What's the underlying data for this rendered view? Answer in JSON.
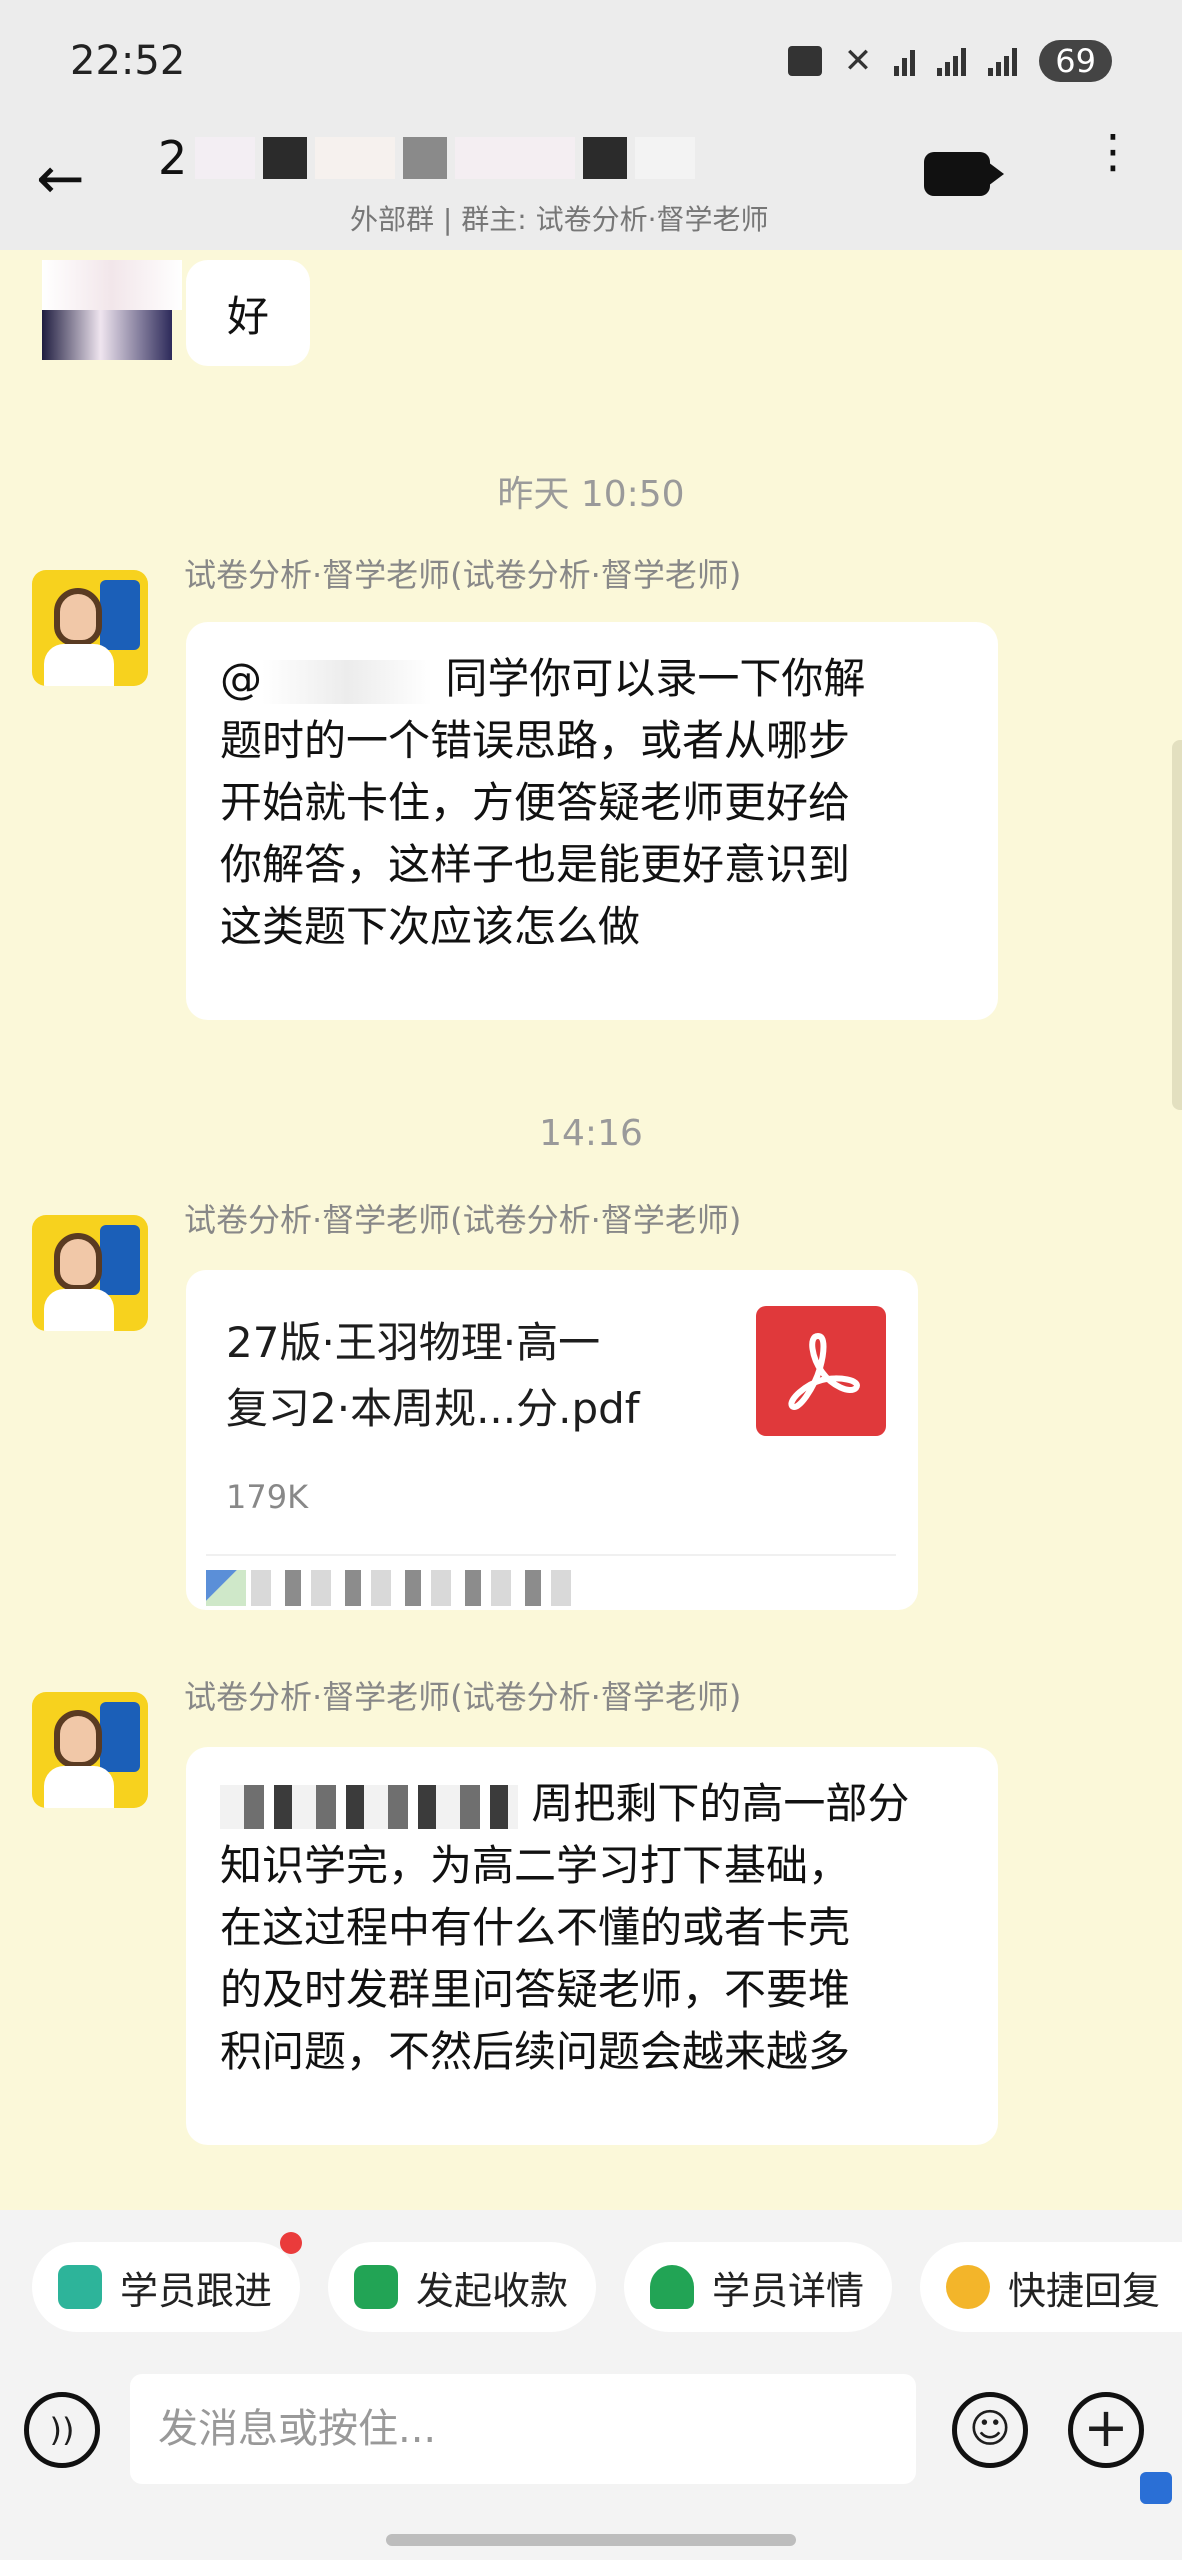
{
  "status_bar": {
    "time": "22:52",
    "battery": "69"
  },
  "header": {
    "title_visible": "2",
    "subtitle": "外部群 | 群主: 试卷分析·督学老师"
  },
  "chat": {
    "messages": [
      {
        "type": "text",
        "sender": "",
        "text": "好"
      },
      {
        "type": "timestamp",
        "text": "昨天 10:50"
      },
      {
        "type": "text",
        "sender": "试卷分析·督学老师(试卷分析·督学老师)",
        "lines": [
          "同学你可以录一下你解",
          "题时的一个错误思路，或者从哪步",
          "开始就卡住，方便答疑老师更好给",
          "你解答，这样子也是能更好意识到",
          "这类题下次应该怎么做"
        ],
        "mention": "@"
      },
      {
        "type": "timestamp",
        "text": "14:16"
      },
      {
        "type": "file",
        "sender": "试卷分析·督学老师(试卷分析·督学老师)",
        "file_name_lines": [
          "27版·王羽物理·高一",
          "复习2·本周规...分.pdf"
        ],
        "file_size": "179K",
        "icon": "pdf-icon"
      },
      {
        "type": "text",
        "sender": "试卷分析·督学老师(试卷分析·督学老师)",
        "lines": [
          "周把剩下的高一部分",
          "知识学完，为高二学习打下基础，",
          "在这过程中有什么不懂的或者卡壳",
          "的及时发群里问答疑老师，不要堆",
          "积问题，不然后续问题会越来越多"
        ]
      }
    ]
  },
  "quick_actions": [
    {
      "label": "学员跟进",
      "color": "#2DB49A",
      "icon": "follow-up-icon",
      "has_dot": true
    },
    {
      "label": "发起收款",
      "color": "#22A455",
      "icon": "payment-icon",
      "has_dot": false
    },
    {
      "label": "学员详情",
      "color": "#22A455",
      "icon": "student-detail-icon",
      "has_dot": false
    },
    {
      "label": "快捷回复",
      "color": "#F3B52A",
      "icon": "quick-reply-icon",
      "has_dot": false
    }
  ],
  "input": {
    "placeholder": "发消息或按住..."
  }
}
